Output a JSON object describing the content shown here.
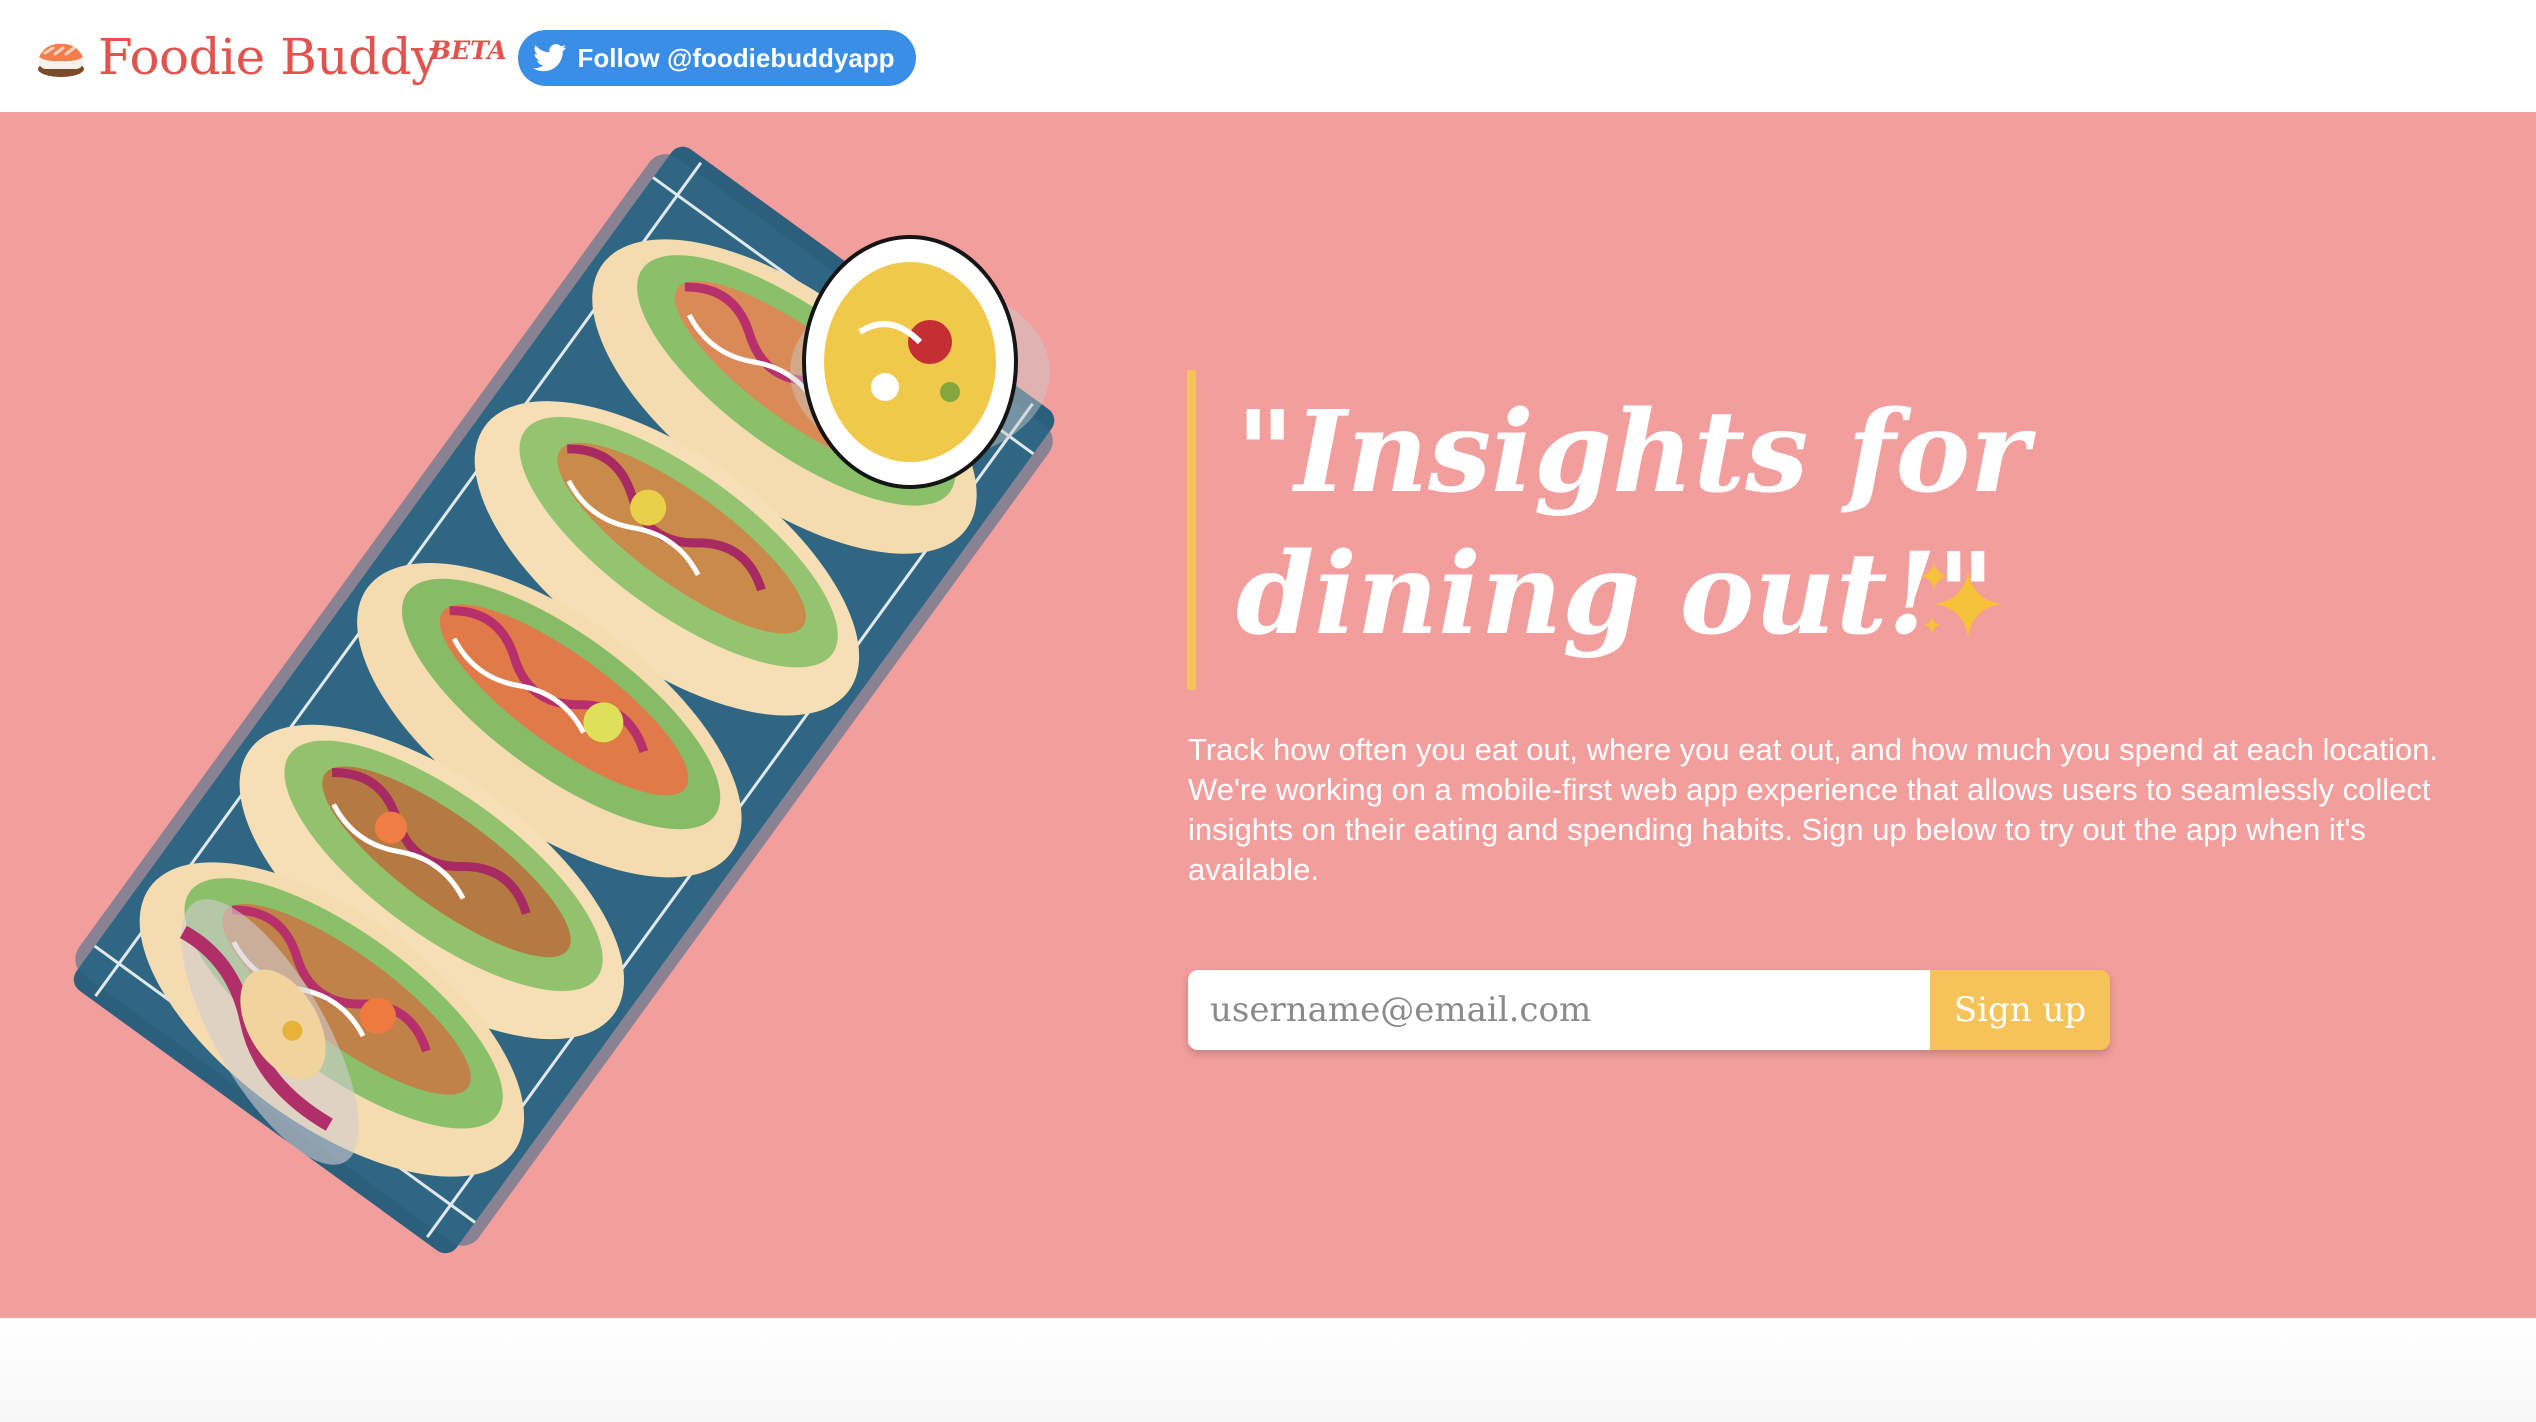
{
  "header": {
    "brand": "Foodie Buddy",
    "beta": "BETA",
    "follow_label": "Follow @foodiebuddyapp"
  },
  "hero": {
    "headline_line1": "\"Insights for",
    "headline_line2": "dining out!\"",
    "description": "Track how often you eat out, where you eat out, and how much you spend at each location. We're working on a mobile-first web app experience that allows users to seamlessly collect insights on their eating and spending habits. Sign up below to try out the app when it's available.",
    "email_placeholder": "username@email.com",
    "signup_label": "Sign up"
  },
  "icons": {
    "logo": "sushi-icon",
    "follow": "twitter-icon",
    "headline_decoration": "sparkles-icon"
  },
  "colors": {
    "brand": "#e2534e",
    "hero_background": "#f29e9d",
    "accent": "#f6c35a",
    "twitter": "#3a8ee6",
    "tray": "#2f6480"
  }
}
